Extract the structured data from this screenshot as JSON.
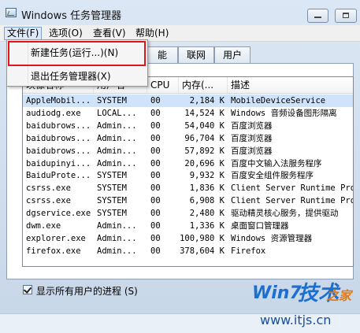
{
  "window": {
    "title": "Windows 任务管理器",
    "caption_minimize": "",
    "caption_maximize": ""
  },
  "menubar": {
    "items": [
      "文件(F)",
      "选项(O)",
      "查看(V)",
      "帮助(H)"
    ]
  },
  "file_menu": {
    "items": [
      "新建任务(运行...)(N)",
      "退出任务管理器(X)"
    ]
  },
  "tabs": {
    "visible": [
      "能",
      "联网",
      "用户"
    ]
  },
  "process_list": {
    "columns": [
      "映像名称",
      "用户名",
      "CPU",
      "内存(...",
      "描述"
    ],
    "rows": [
      {
        "name": "AppleMobil...",
        "user": "SYSTEM",
        "cpu": "00",
        "mem": "2,184 K",
        "desc": "MobileDeviceService",
        "selected": true
      },
      {
        "name": "audiodg.exe",
        "user": "LOCAL...",
        "cpu": "00",
        "mem": "14,524 K",
        "desc": "Windows 音频设备图形隔离"
      },
      {
        "name": "baidubrows...",
        "user": "Admin...",
        "cpu": "00",
        "mem": "54,040 K",
        "desc": "百度浏览器"
      },
      {
        "name": "baidubrows...",
        "user": "Admin...",
        "cpu": "00",
        "mem": "96,704 K",
        "desc": "百度浏览器"
      },
      {
        "name": "baidubrows...",
        "user": "Admin...",
        "cpu": "00",
        "mem": "57,892 K",
        "desc": "百度浏览器"
      },
      {
        "name": "baidupinyi...",
        "user": "Admin...",
        "cpu": "00",
        "mem": "20,696 K",
        "desc": "百度中文输入法服务程序"
      },
      {
        "name": "BaiduProte...",
        "user": "SYSTEM",
        "cpu": "00",
        "mem": "9,932 K",
        "desc": "百度安全组件服务程序"
      },
      {
        "name": "csrss.exe",
        "user": "SYSTEM",
        "cpu": "00",
        "mem": "1,836 K",
        "desc": "Client Server Runtime Proc"
      },
      {
        "name": "csrss.exe",
        "user": "SYSTEM",
        "cpu": "00",
        "mem": "6,908 K",
        "desc": "Client Server Runtime Proc"
      },
      {
        "name": "dgservice.exe",
        "user": "SYSTEM",
        "cpu": "00",
        "mem": "2,480 K",
        "desc": "驱动精灵核心服务，提供驱动"
      },
      {
        "name": "dwm.exe",
        "user": "Admin...",
        "cpu": "00",
        "mem": "1,336 K",
        "desc": "桌面窗口管理器"
      },
      {
        "name": "explorer.exe",
        "user": "Admin...",
        "cpu": "00",
        "mem": "100,980 K",
        "desc": "Windows 资源管理器"
      },
      {
        "name": "firefox.exe",
        "user": "Admin...",
        "cpu": "00",
        "mem": "378,604 K",
        "desc": "Firefox"
      }
    ]
  },
  "show_all_users": {
    "label": "显示所有用户的进程 (S)",
    "checked": true
  },
  "watermark": {
    "logo_text_a": "Win7",
    "logo_text_b": "技术",
    "logo_text_c": "之家",
    "url": "www.itjs.cn"
  },
  "colors": {
    "highlight_box": "#e3131b",
    "selection": "#cfe3fb",
    "watermark_blue": "#1a4fa0"
  }
}
